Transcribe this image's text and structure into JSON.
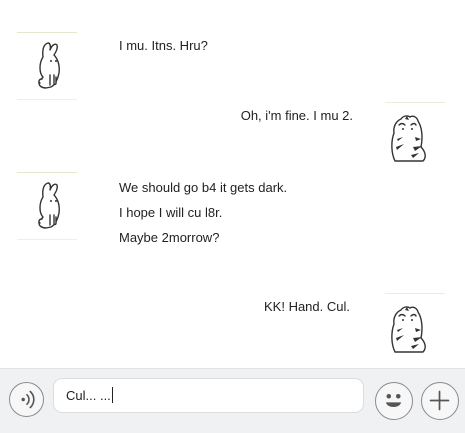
{
  "conversation": {
    "messages": [
      {
        "side": "left",
        "sender": "bunny",
        "lines": [
          "I mu. Itns. Hru?"
        ]
      },
      {
        "side": "right",
        "sender": "tiger",
        "lines": [
          "Oh, i'm fine. I mu 2."
        ]
      },
      {
        "side": "left",
        "sender": "bunny",
        "lines": [
          "We should go b4 it gets dark.",
          "I hope I will cu l8r.",
          "Maybe 2morrow?"
        ]
      },
      {
        "side": "right",
        "sender": "tiger",
        "lines": [
          "KK! Hand. Cul."
        ]
      }
    ]
  },
  "input_bar": {
    "value": "Cul... ...",
    "voice_icon": "voice-icon",
    "emoji_icon": "smiley-icon",
    "add_icon": "plus-icon"
  },
  "colors": {
    "bar_background": "#f0f1f3",
    "text": "#222222",
    "button_border": "#8a8b8e"
  }
}
